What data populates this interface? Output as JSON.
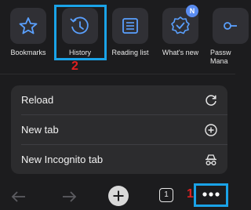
{
  "shortcuts": [
    {
      "label": "Bookmarks",
      "icon": "star-icon"
    },
    {
      "label": "History",
      "icon": "history-icon"
    },
    {
      "label": "Reading list",
      "icon": "reading-list-icon"
    },
    {
      "label": "What's new",
      "icon": "whats-new-icon",
      "badge": "N"
    },
    {
      "label": "Passw Mana",
      "icon": "password-manager-icon"
    }
  ],
  "annotations": {
    "step1": "1",
    "step2": "2",
    "highlight_color": "#1aa3e8",
    "step_color": "#e02020"
  },
  "menu": {
    "items": [
      {
        "label": "Reload",
        "icon": "reload-icon"
      },
      {
        "label": "New tab",
        "icon": "new-tab-icon"
      },
      {
        "label": "New Incognito tab",
        "icon": "incognito-icon"
      }
    ]
  },
  "toolbar": {
    "back": "back-arrow-icon",
    "forward": "forward-arrow-icon",
    "new_tab": "plus-icon",
    "tab_count": "1",
    "more": "more-dots-icon"
  }
}
